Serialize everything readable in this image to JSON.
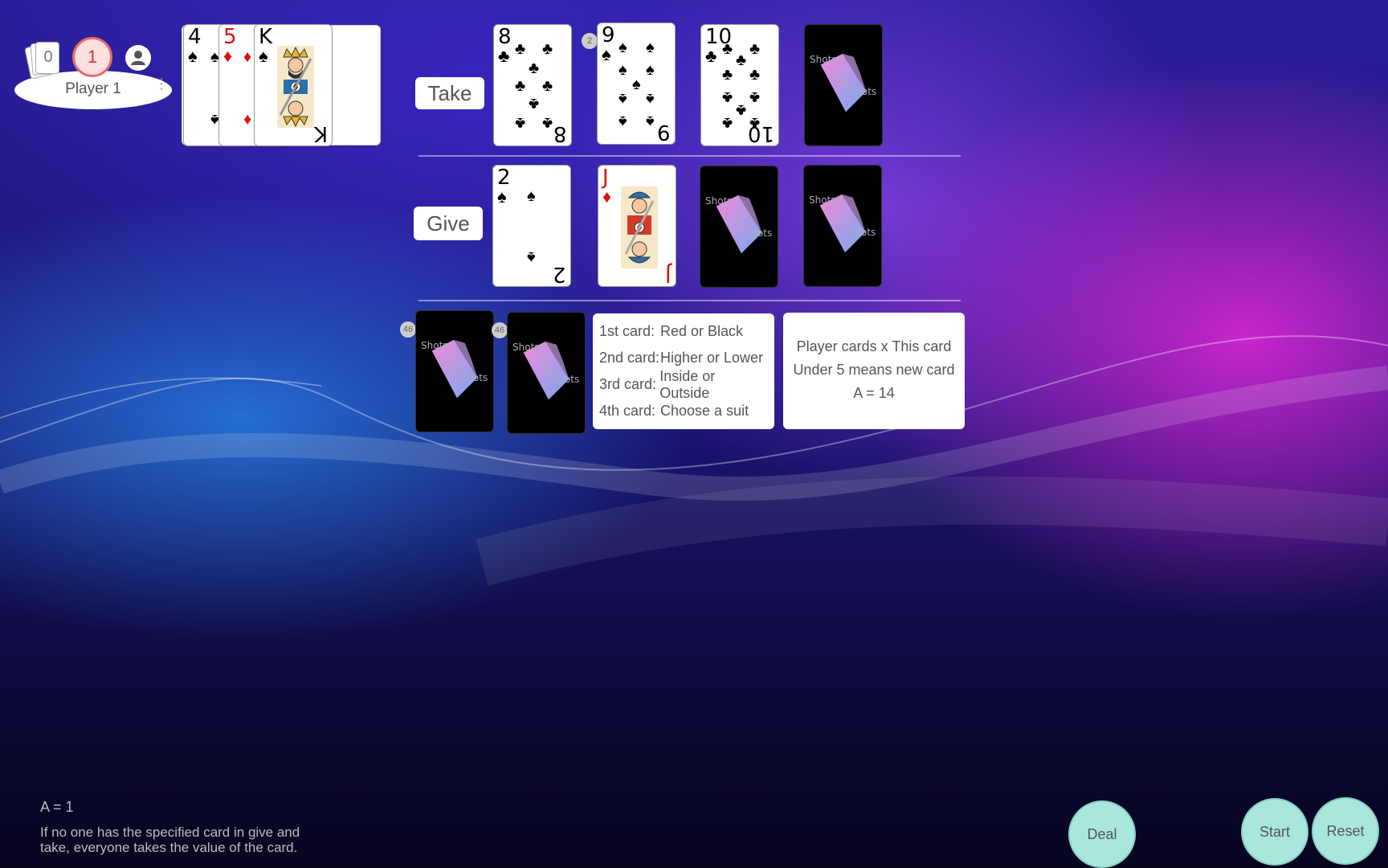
{
  "player": {
    "deck_count": "0",
    "turn_number": "1",
    "name": "Player 1",
    "menu_glyph": "⋮"
  },
  "hand": [
    {
      "rank": "4",
      "suit": "♠",
      "color": "#000000"
    },
    {
      "rank": "5",
      "suit": "♦",
      "color": "#e01010"
    },
    {
      "rank": "K",
      "suit": "♠",
      "color": "#000000"
    }
  ],
  "take": {
    "label": "Take",
    "cards": [
      {
        "rank": "8",
        "suit": "♣",
        "face": "up"
      },
      {
        "rank": "9",
        "suit": "♠",
        "face": "up",
        "badge": "2"
      },
      {
        "rank": "10",
        "suit": "♣",
        "face": "up"
      },
      {
        "face": "down"
      }
    ]
  },
  "give": {
    "label": "Give",
    "cards": [
      {
        "rank": "2",
        "suit": "♠",
        "face": "up"
      },
      {
        "rank": "J",
        "suit": "♦",
        "face": "up"
      },
      {
        "face": "down"
      },
      {
        "face": "down"
      }
    ]
  },
  "card_back": {
    "line1": "Shots",
    "line2": "&",
    "line3": "Thots"
  },
  "piles": [
    {
      "badge": "46"
    },
    {
      "badge": "46"
    }
  ],
  "rules": [
    {
      "key": "1st card:",
      "value": "Red or Black"
    },
    {
      "key": "2nd card:",
      "value": "Higher or Lower"
    },
    {
      "key": "3rd card:",
      "value": "Inside or Outside"
    },
    {
      "key": "4th card:",
      "value": "Choose a suit"
    }
  ],
  "info": [
    "Player cards x This card",
    "Under 5 means new card",
    "A = 14"
  ],
  "footer": {
    "ace_note": "A = 1",
    "description": "If no one has the specified card in give and take, everyone takes the value of the card."
  },
  "buttons": {
    "deal": "Deal",
    "start": "Start",
    "reset": "Reset"
  }
}
